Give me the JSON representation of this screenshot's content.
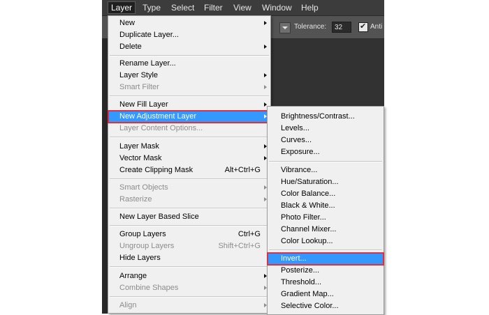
{
  "menubar": {
    "items": [
      {
        "label": "Layer",
        "active": true
      },
      {
        "label": "Type"
      },
      {
        "label": "Select"
      },
      {
        "label": "Filter"
      },
      {
        "label": "View"
      },
      {
        "label": "Window"
      },
      {
        "label": "Help"
      }
    ]
  },
  "options_bar": {
    "tolerance_label": "Tolerance:",
    "tolerance_value": "32",
    "antialias_label": "Anti",
    "antialias_checked": true
  },
  "layer_menu": {
    "items": [
      {
        "label": "New",
        "submenu": true
      },
      {
        "label": "Duplicate Layer..."
      },
      {
        "label": "Delete",
        "submenu": true
      },
      {
        "label": "Rename Layer..."
      },
      {
        "label": "Layer Style",
        "submenu": true
      },
      {
        "label": "Smart Filter",
        "submenu": true,
        "disabled": true
      },
      {
        "label": "New Fill Layer",
        "submenu": true
      },
      {
        "label": "New Adjustment Layer",
        "submenu": true,
        "highlighted": true
      },
      {
        "label": "Layer Content Options...",
        "disabled": true
      },
      {
        "label": "Layer Mask",
        "submenu": true
      },
      {
        "label": "Vector Mask",
        "submenu": true
      },
      {
        "label": "Create Clipping Mask",
        "shortcut": "Alt+Ctrl+G"
      },
      {
        "label": "Smart Objects",
        "submenu": true,
        "disabled": true
      },
      {
        "label": "Rasterize",
        "submenu": true,
        "disabled": true
      },
      {
        "label": "New Layer Based Slice"
      },
      {
        "label": "Group Layers",
        "shortcut": "Ctrl+G"
      },
      {
        "label": "Ungroup Layers",
        "shortcut": "Shift+Ctrl+G",
        "disabled": true
      },
      {
        "label": "Hide Layers"
      },
      {
        "label": "Arrange",
        "submenu": true
      },
      {
        "label": "Combine Shapes",
        "submenu": true,
        "disabled": true
      },
      {
        "label": "Align",
        "submenu": true,
        "disabled": true
      }
    ]
  },
  "adjustment_menu": {
    "items": [
      {
        "label": "Brightness/Contrast..."
      },
      {
        "label": "Levels..."
      },
      {
        "label": "Curves..."
      },
      {
        "label": "Exposure..."
      },
      {
        "label": "Vibrance..."
      },
      {
        "label": "Hue/Saturation..."
      },
      {
        "label": "Color Balance..."
      },
      {
        "label": "Black & White..."
      },
      {
        "label": "Photo Filter..."
      },
      {
        "label": "Channel Mixer..."
      },
      {
        "label": "Color Lookup..."
      },
      {
        "label": "Invert...",
        "highlighted": true
      },
      {
        "label": "Posterize..."
      },
      {
        "label": "Threshold..."
      },
      {
        "label": "Gradient Map..."
      },
      {
        "label": "Selective Color..."
      }
    ]
  },
  "colors": {
    "highlight": "#3399ff",
    "callout_border": "#e03040",
    "menu_background": "#f0f0f0",
    "disabled_text": "#8c8c8c",
    "app_background": "#323232"
  }
}
